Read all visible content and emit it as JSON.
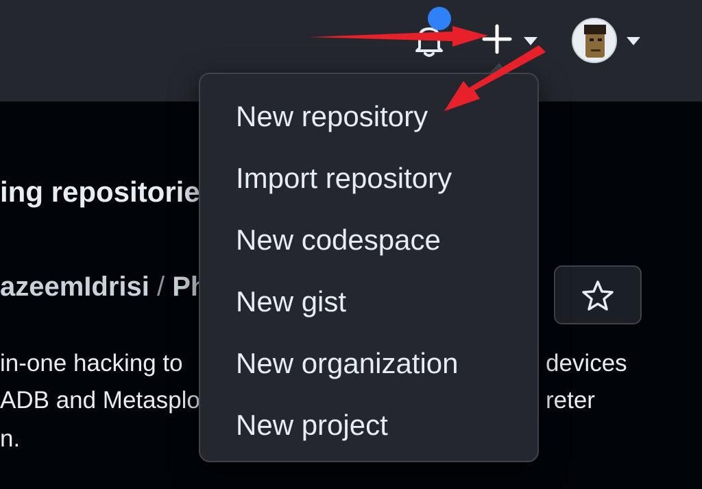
{
  "header": {
    "notification_icon": "bell-icon",
    "create_icon": "plus-icon",
    "create_caret_icon": "caret-down-icon",
    "avatar_caret_icon": "caret-down-icon",
    "notification_dot_color": "#2f81f7"
  },
  "background": {
    "section_heading": "ing repositorie",
    "repo_owner": "azeemIdrisi",
    "repo_separator": " / ",
    "repo_name_partial": "Ph",
    "description_lines": [
      "in-one hacking to",
      "devices",
      "ADB and Metasplo",
      "reter",
      "n."
    ],
    "star_icon": "star-icon"
  },
  "menu": {
    "items": [
      {
        "label": "New repository"
      },
      {
        "label": "Import repository"
      },
      {
        "label": "New codespace"
      },
      {
        "label": "New gist"
      },
      {
        "label": "New organization"
      },
      {
        "label": "New project"
      }
    ]
  },
  "annotation": {
    "arrow_color": "#e8202a"
  }
}
